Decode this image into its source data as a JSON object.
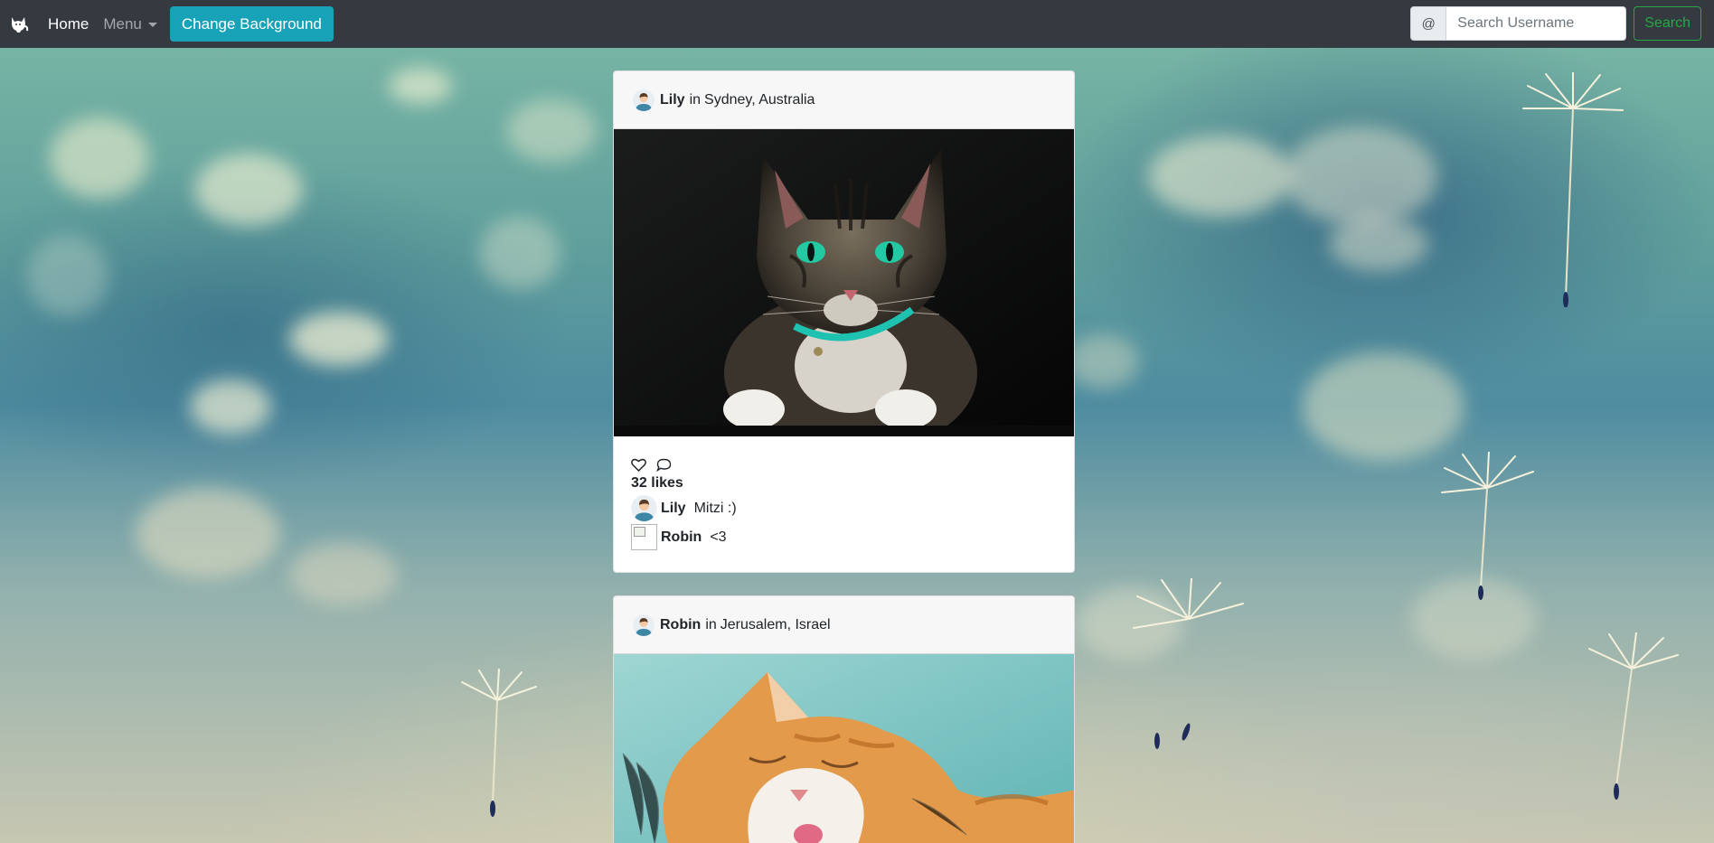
{
  "navbar": {
    "brand_icon": "cat-logo-icon",
    "home_label": "Home",
    "menu_label": "Menu",
    "change_bg_label": "Change Background",
    "search_prefix": "@",
    "search_placeholder": "Search Username",
    "search_button_label": "Search"
  },
  "posts": [
    {
      "author": "Lily",
      "location_prefix": "in",
      "location": "Sydney, Australia",
      "image_subject": "tabby cat with green eyes on dark background",
      "likes_text": "32 likes",
      "comments": [
        {
          "user": "Lily",
          "text": "Mitzi :)",
          "avatar": "user-avatar"
        },
        {
          "user": "Robin",
          "text": "<3",
          "avatar": "broken-image"
        }
      ]
    },
    {
      "author": "Robin",
      "location_prefix": "in",
      "location": "Jerusalem, Israel",
      "image_subject": "orange and white cat squinting"
    }
  ],
  "colors": {
    "navbar": "#343a40",
    "info_button": "#17a2b8",
    "success_outline": "#28a745"
  }
}
